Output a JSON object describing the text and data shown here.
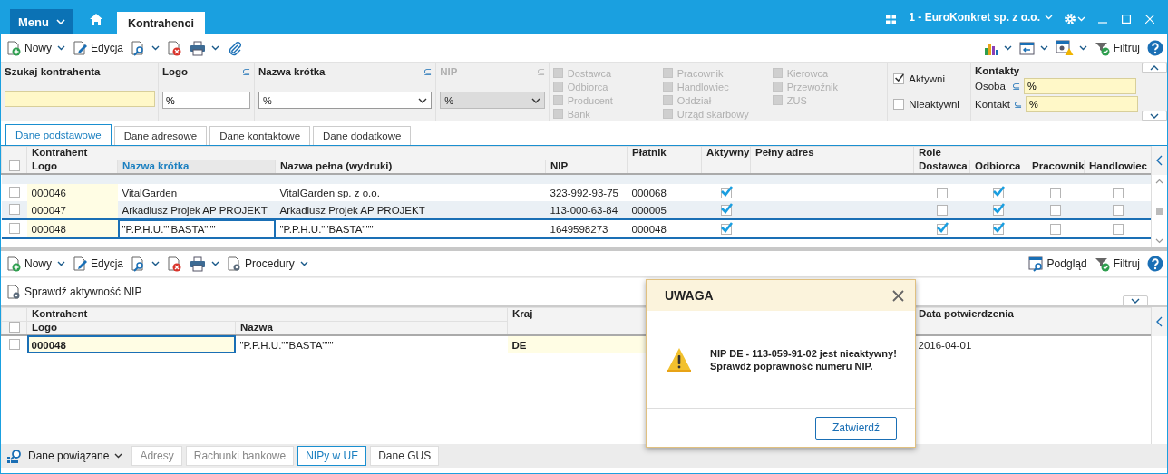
{
  "title_bar": {
    "menu": "Menu",
    "tabs": [
      {
        "label": "Kontrahenci",
        "selected": true
      }
    ],
    "company": "1 - EuroKonkret sp. z o.o."
  },
  "toolbar": {
    "left": [
      {
        "kind": "new",
        "label": "Nowy",
        "dropdown": true
      },
      {
        "kind": "edit",
        "label": "Edycja",
        "dropdown": false
      },
      {
        "kind": "search",
        "dropdown": true
      },
      {
        "kind": "delete",
        "dropdown": false
      },
      {
        "kind": "print",
        "dropdown": true
      },
      {
        "kind": "attach",
        "dropdown": false
      }
    ],
    "right": [
      {
        "kind": "chart",
        "dropdown": true
      },
      {
        "kind": "window",
        "dropdown": true
      },
      {
        "kind": "settings",
        "dropdown": true
      },
      {
        "kind": "filter",
        "label": "Filtruj",
        "dropdown": false
      },
      {
        "kind": "help",
        "dropdown": false
      }
    ]
  },
  "filters": {
    "search": {
      "label": "Szukaj kontrahenta"
    },
    "fields": [
      {
        "label": "Logo",
        "op": "⊆",
        "value": "%",
        "kind": "input",
        "disabled": false
      },
      {
        "label": "Nazwa krótka",
        "op": "⊆",
        "value": "%",
        "kind": "select",
        "disabled": false
      },
      {
        "label": "NIP",
        "op": "⊆",
        "value": "%",
        "kind": "select",
        "disabled": true
      }
    ],
    "roles": [
      {
        "label": "Dostawca",
        "checked": false,
        "disabled": true
      },
      {
        "label": "Odbiorca",
        "checked": false,
        "disabled": true
      },
      {
        "label": "Producent",
        "checked": false,
        "disabled": true
      },
      {
        "label": "Bank",
        "checked": false,
        "disabled": true
      },
      {
        "label": "Pracownik",
        "checked": false,
        "disabled": true
      },
      {
        "label": "Handlowiec",
        "checked": false,
        "disabled": true
      },
      {
        "label": "Oddział",
        "checked": false,
        "disabled": true
      },
      {
        "label": "Urząd skarbowy",
        "checked": false,
        "disabled": true
      },
      {
        "label": "Kierowca",
        "checked": false,
        "disabled": true
      },
      {
        "label": "Przewoźnik",
        "checked": false,
        "disabled": true
      },
      {
        "label": "ZUS",
        "checked": false,
        "disabled": true
      }
    ],
    "status": [
      {
        "label": "Aktywni",
        "checked": true
      },
      {
        "label": "Nieaktywni",
        "checked": false
      }
    ],
    "contacts": {
      "title": "Kontakty",
      "fields": [
        {
          "label": "Osoba",
          "op": "⊆",
          "value": "%"
        },
        {
          "label": "Kontakt",
          "op": "⊆",
          "value": "%"
        }
      ]
    }
  },
  "tabs": [
    {
      "label": "Dane podstawowe",
      "selected": true
    },
    {
      "label": "Dane adresowe",
      "selected": false
    },
    {
      "label": "Dane kontaktowe",
      "selected": false
    },
    {
      "label": "Dane dodatkowe",
      "selected": false
    }
  ],
  "grid": {
    "select_all": {
      "checked": false
    },
    "group": "Kontrahent",
    "columns": [
      {
        "label": "Logo",
        "sorted": false
      },
      {
        "label": "Nazwa krótka",
        "sorted": true
      },
      {
        "label": "Nazwa pełna (wydruki)",
        "sorted": false
      },
      {
        "label": "NIP",
        "sorted": false
      }
    ],
    "payer": "Płatnik",
    "active": "Aktywny",
    "address": "Pełny adres",
    "roles_group": "Role",
    "roles": [
      "Dostawca",
      "Odbiorca",
      "Pracownik",
      "Handlowiec"
    ],
    "rows": [
      {
        "checked": false,
        "logo": "000046",
        "short_name": "VitalGarden",
        "full_name": "VitalGarden sp. z o.o.",
        "nip": "323-992-93-75",
        "payer": "000068",
        "active": true,
        "roles": [
          false,
          true,
          false,
          false
        ],
        "selected": false
      },
      {
        "checked": false,
        "logo": "000047",
        "short_name": "Arkadiusz Projek AP PROJEKT",
        "full_name": "Arkadiusz Projek AP PROJEKT",
        "nip": "113-000-63-84",
        "payer": "000005",
        "active": true,
        "roles": [
          false,
          true,
          false,
          false
        ],
        "selected": false
      },
      {
        "checked": false,
        "logo": "000048",
        "short_name": "\"P.P.H.U.\"\"BASTA\"\"\"",
        "full_name": "\"P.P.H.U.\"\"BASTA\"\"\"",
        "nip": "1649598273",
        "payer": "000048",
        "active": true,
        "roles": [
          true,
          true,
          false,
          false
        ],
        "selected": true
      }
    ]
  },
  "toolbar2": {
    "left": [
      {
        "kind": "new",
        "label": "Nowy",
        "dropdown": true
      },
      {
        "kind": "edit",
        "label": "Edycja",
        "dropdown": false
      },
      {
        "kind": "search",
        "dropdown": true
      },
      {
        "kind": "delete",
        "dropdown": false
      },
      {
        "kind": "print",
        "dropdown": true
      },
      {
        "kind": "procedures",
        "label": "Procedury",
        "dropdown": true
      }
    ],
    "right": [
      {
        "kind": "preview",
        "label": "Podgląd",
        "dropdown": false
      },
      {
        "kind": "filter",
        "label": "Filtruj",
        "dropdown": false
      },
      {
        "kind": "help",
        "dropdown": false
      }
    ]
  },
  "action": {
    "kind": "procedures",
    "label": "Sprawdź aktywność NIP"
  },
  "grid2": {
    "select_all": {
      "checked": false
    },
    "group": "Kontrahent",
    "columns": [
      "Logo",
      "Nazwa"
    ],
    "country": "Kraj",
    "date": "Data potwierdzenia",
    "rows": [
      {
        "checked": false,
        "logo": "000048",
        "name": "\"P.P.H.U.\"\"BASTA\"\"\"",
        "country": "DE",
        "date": "2016-04-01",
        "selected": true
      }
    ]
  },
  "bottom": {
    "linked": "Dane powiązane",
    "tabs": [
      {
        "label": "Adresy",
        "selected": false,
        "disabled": true
      },
      {
        "label": "Rachunki bankowe",
        "selected": false,
        "disabled": true
      },
      {
        "label": "NIPy w UE",
        "selected": true,
        "disabled": false
      },
      {
        "label": "Dane GUS",
        "selected": false,
        "disabled": false
      }
    ]
  },
  "dialog": {
    "title": "UWAGA",
    "lines": [
      "NIP DE - 113-059-91-02 jest nieaktywny!",
      "Sprawdź poprawność numeru NIP."
    ],
    "button": "Zatwierdź"
  }
}
